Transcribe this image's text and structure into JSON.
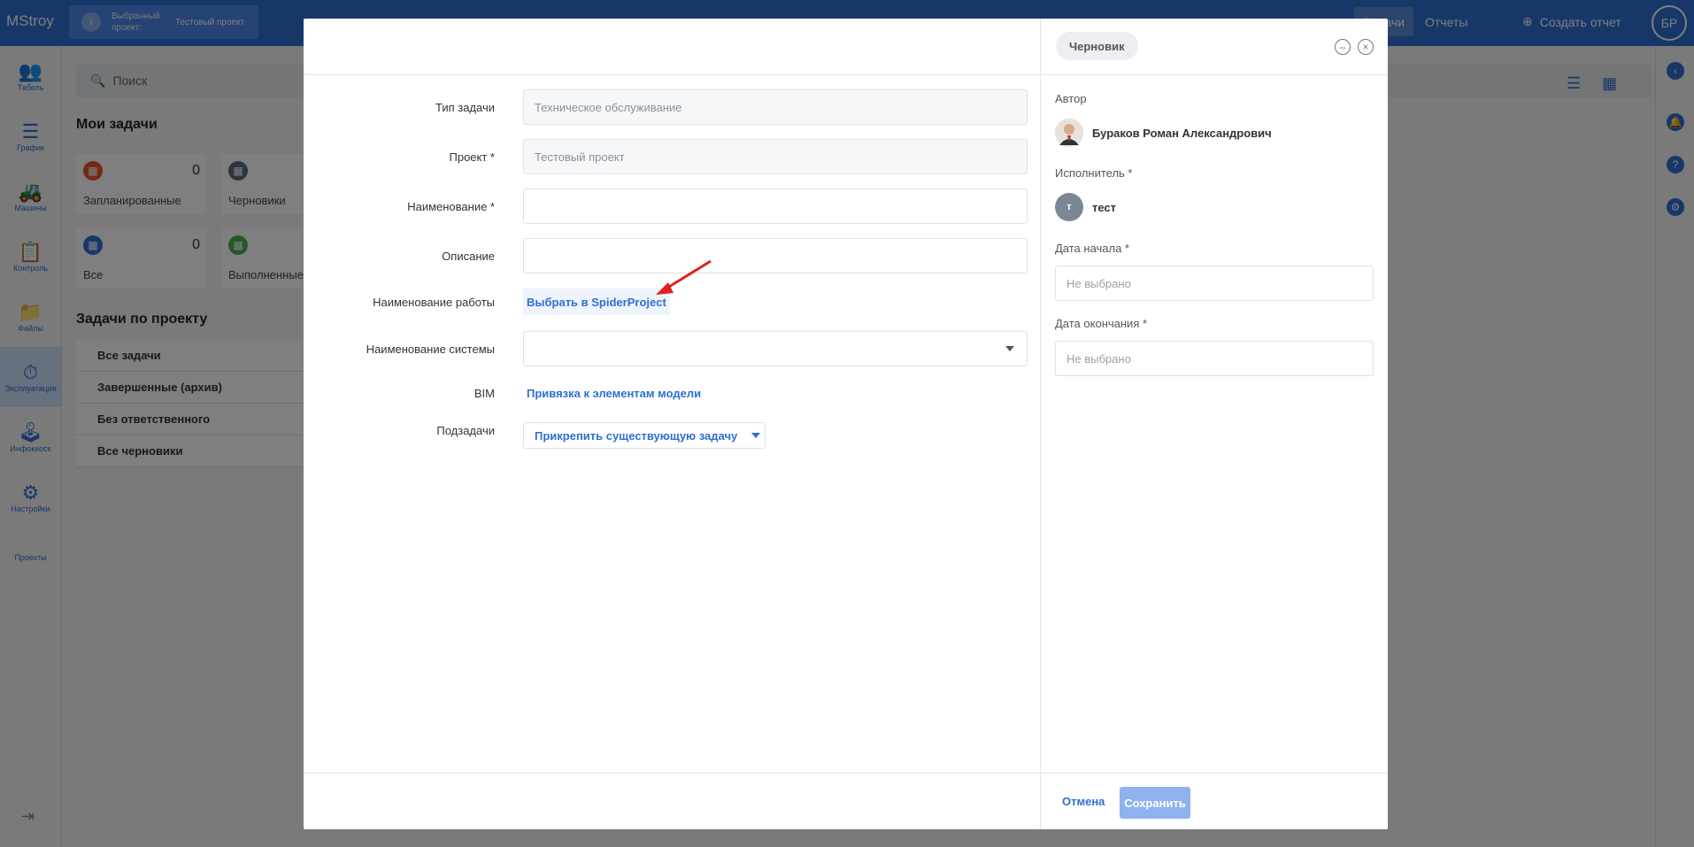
{
  "app": {
    "logo": "MStroy",
    "selected_project_label": "Выбранный проект:",
    "selected_project_value": "Тестовый проект",
    "top_tab_tasks": "Задачи",
    "top_tab_reports": "Отчеты",
    "create_report": "Создать отчет",
    "user_initials": "БР",
    "nav": [
      "Табель",
      "График",
      "Машины",
      "Контроль",
      "Файлы",
      "Эксплуатация",
      "Инфокиоск",
      "Настройки",
      "Проекты"
    ],
    "search_placeholder": "Поиск",
    "my_tasks_title": "Мои задачи",
    "cards": [
      {
        "label": "Запланированные",
        "count": "0",
        "color": "#e4572e"
      },
      {
        "label": "Черновики",
        "count": "",
        "color": "#5b6b7f"
      },
      {
        "label": "Все",
        "count": "0",
        "color": "#2f6fd1"
      },
      {
        "label": "Выполненные",
        "count": "",
        "color": "#4caf50"
      }
    ],
    "project_tasks_title": "Задачи по проекту",
    "project_tasks": [
      "Все задачи",
      "Завершенные (архив)",
      "Без ответственного",
      "Все черновики"
    ]
  },
  "modal": {
    "status_badge": "Черновик",
    "fields": {
      "task_type_label": "Тип задачи",
      "task_type_value": "Техническое обслуживание",
      "project_label": "Проект *",
      "project_value": "Тестовый проект",
      "name_label": "Наименование *",
      "name_value": "",
      "description_label": "Описание",
      "description_value": "",
      "work_name_label": "Наименование работы",
      "work_name_button": "Выбрать в SpiderProject",
      "system_name_label": "Наименование системы",
      "system_name_value": "",
      "bim_label": "BIM",
      "bim_link": "Привязка к элементам модели",
      "subtasks_label": "Подзадачи",
      "subtasks_button": "Прикрепить существующую задачу"
    },
    "right": {
      "author_label": "Автор",
      "author_name": "Бураков Роман Александрович",
      "assignee_label": "Исполнитель *",
      "assignee_initial": "т",
      "assignee_name": "тест",
      "start_date_label": "Дата начала *",
      "start_date_placeholder": "Не выбрано",
      "end_date_label": "Дата окончания *",
      "end_date_placeholder": "Не выбрано"
    },
    "footer": {
      "cancel": "Отмена",
      "save": "Сохранить"
    }
  }
}
